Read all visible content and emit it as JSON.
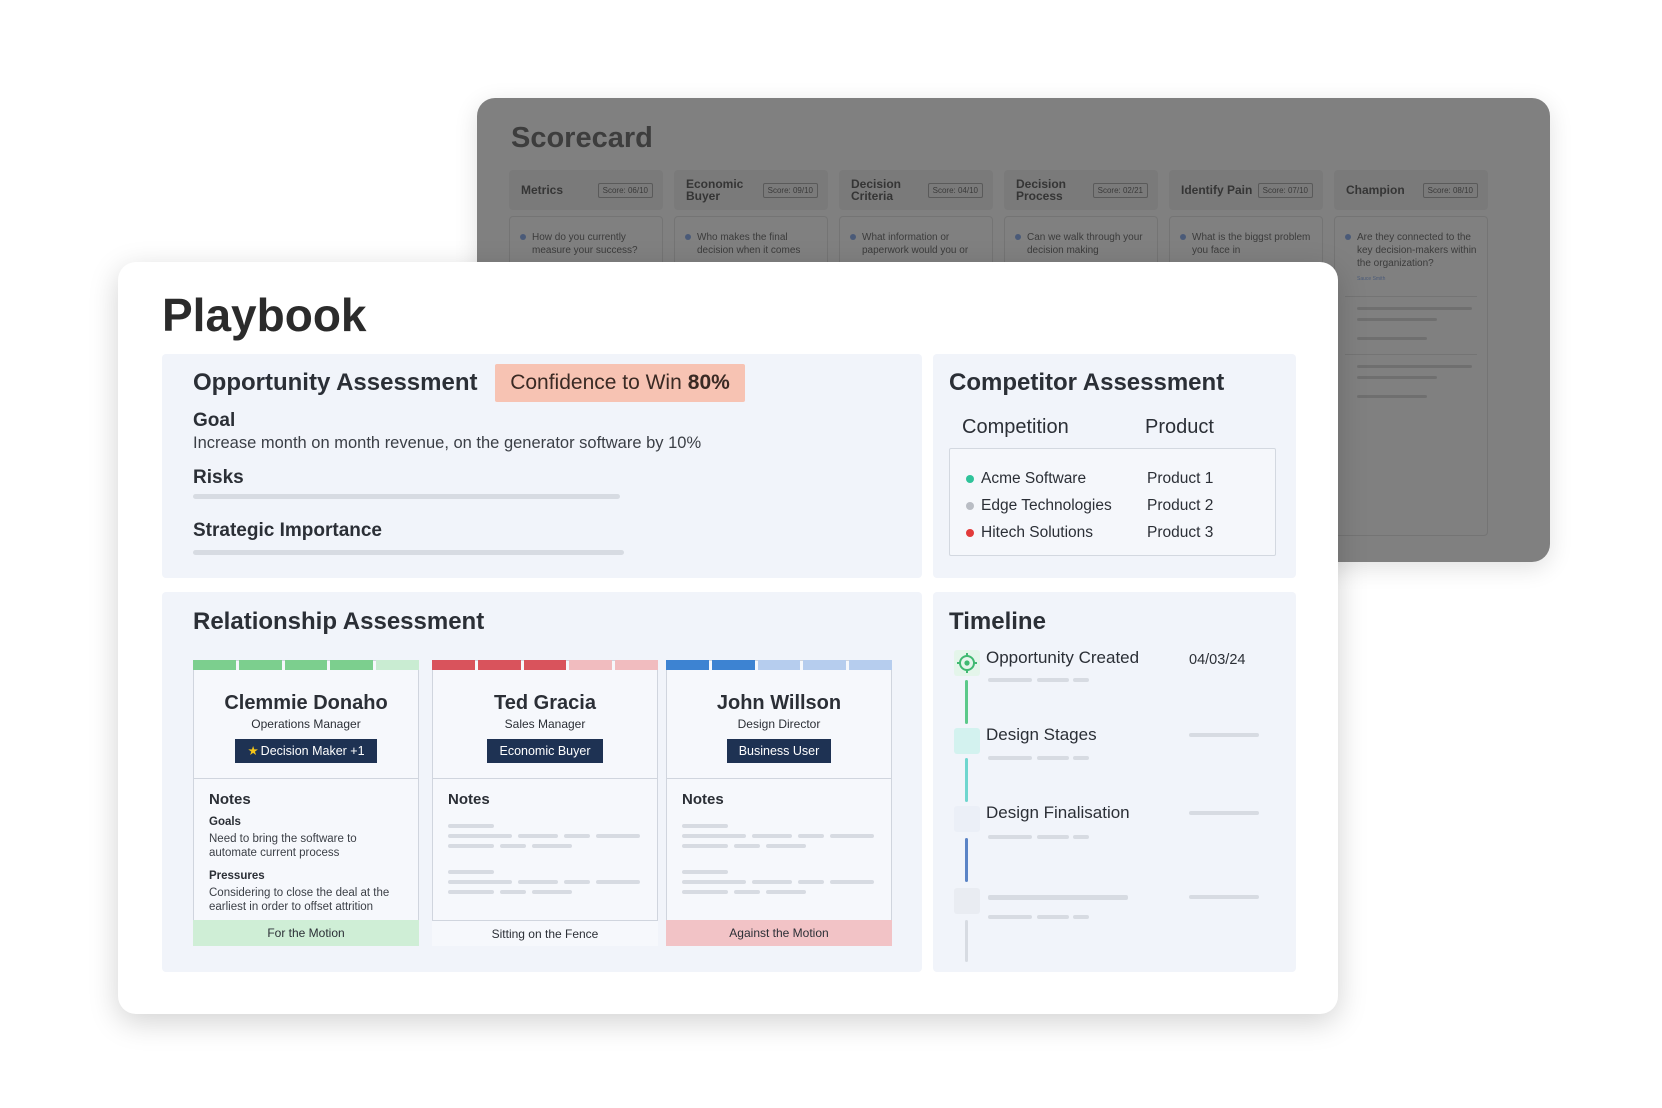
{
  "scorecard": {
    "title": "Scorecard",
    "columns": [
      {
        "label": "Metrics",
        "score": "Score: 06/10",
        "question": "How do you currently measure your success?"
      },
      {
        "label": "Economic Buyer",
        "score": "Score: 09/10",
        "question": "Who makes the final decision when it comes"
      },
      {
        "label": "Decision Criteria",
        "score": "Score: 04/10",
        "question": "What information or paperwork would you or"
      },
      {
        "label": "Decision Process",
        "score": "Score: 02/21",
        "question": "Can we walk through your decision making"
      },
      {
        "label": "Identify Pain",
        "score": "Score: 07/10",
        "question": "What is the biggst problem you face in"
      },
      {
        "label": "Champion",
        "score": "Score: 08/10",
        "question": "Are they connected to the key decision-makers within the organization?",
        "owner": "Sauce Smith"
      }
    ]
  },
  "playbook": {
    "title": "Playbook",
    "opportunity": {
      "title": "Opportunity Assessment",
      "confidence_label": "Confidence to Win",
      "confidence_value": "80%",
      "goal_heading": "Goal",
      "goal_text": "Increase month on month revenue, on the generator software by 10%",
      "risks_heading": "Risks",
      "strategic_heading": "Strategic Importance"
    },
    "competitor": {
      "title": "Competitor Assessment",
      "col_competition": "Competition",
      "col_product": "Product",
      "rows": [
        {
          "name": "Acme Software",
          "product": "Product 1",
          "color": "#2fc39a"
        },
        {
          "name": "Edge Technologies",
          "product": "Product 2",
          "color": "#b9bdc4"
        },
        {
          "name": "Hitech Solutions",
          "product": "Product 3",
          "color": "#e23a3a"
        }
      ]
    },
    "relationship": {
      "title": "Relationship Assessment",
      "cards": [
        {
          "name": "Clemmie Donaho",
          "role": "Operations Manager",
          "badge": "Decision Maker +1",
          "notes_title": "Notes",
          "goals_heading": "Goals",
          "goals_text": "Need to bring the software to automate current process",
          "pressures_heading": "Pressures",
          "pressures_text": "Considering to close the deal at the earliest in order to offset attrition",
          "stance": "For the Motion",
          "stance_color": "#cfeed6",
          "stripe": [
            "#7ccf8e",
            "#7ccf8e",
            "#7ccf8e",
            "#7ccf8e",
            "#c9ecd2"
          ]
        },
        {
          "name": "Ted Gracia",
          "role": "Sales Manager",
          "badge": "Economic Buyer",
          "notes_title": "Notes",
          "stance": "Sitting on the Fence",
          "stance_color": "#f6f8fc",
          "stripe": [
            "#d9535c",
            "#d9535c",
            "#d9535c",
            "#f1bcbf",
            "#f1bcbf"
          ]
        },
        {
          "name": "John Willson",
          "role": "Design Director",
          "badge": "Business User",
          "notes_title": "Notes",
          "stance": "Against the Motion",
          "stance_color": "#f2c3c6",
          "stripe": [
            "#3d83d2",
            "#3d83d2",
            "#b6cdee",
            "#b6cdee",
            "#b6cdee"
          ]
        }
      ]
    },
    "timeline": {
      "title": "Timeline",
      "items": [
        {
          "label": "Opportunity Created",
          "date": "04/03/24"
        },
        {
          "label": "Design Stages"
        },
        {
          "label": "Design Finalisation"
        }
      ]
    }
  },
  "colors": {
    "panel_bg": "#f1f4fa",
    "scorecard_bg": "#808080",
    "badge_navy": "#1e3253",
    "confidence_bg": "#f7c3b3"
  },
  "icons": {
    "timeline_start": "target-icon",
    "badge_star": "star-icon",
    "competitor_bullet": "dot-icon"
  }
}
